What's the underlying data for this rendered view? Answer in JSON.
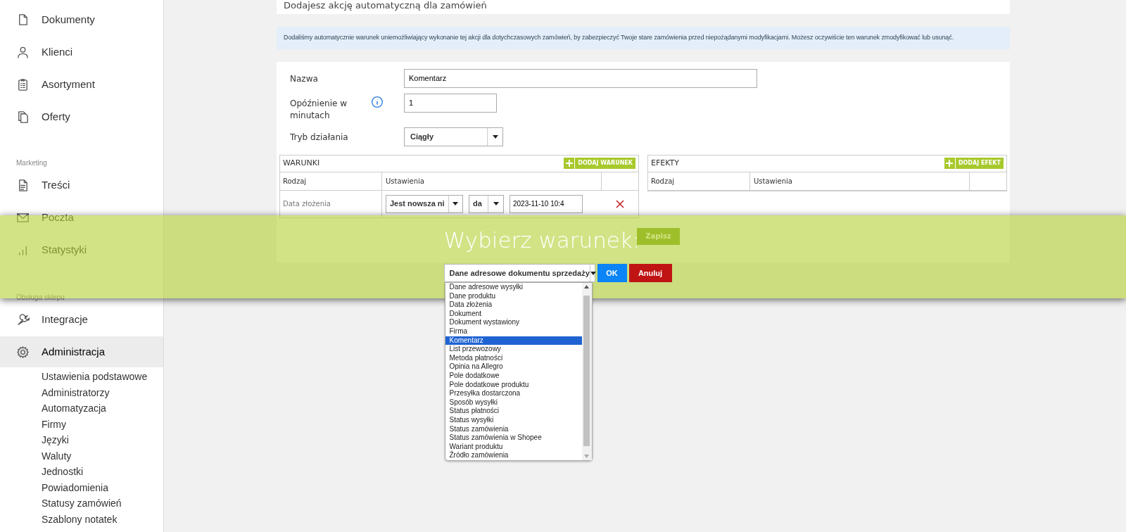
{
  "sidebar": {
    "sections": [
      {
        "items": [
          {
            "label": "Dokumenty",
            "selected": false
          },
          {
            "label": "Klienci",
            "selected": false
          },
          {
            "label": "Asortyment",
            "selected": false
          },
          {
            "label": "Oferty",
            "selected": false
          }
        ]
      },
      {
        "heading": "Marketing",
        "items": [
          {
            "label": "Treści",
            "selected": false
          },
          {
            "label": "Poczta",
            "selected": false
          },
          {
            "label": "Statystyki",
            "selected": false
          }
        ]
      },
      {
        "heading": "Obsługa sklepu",
        "items": [
          {
            "label": "Integracje",
            "selected": false
          },
          {
            "label": "Administracja",
            "selected": true,
            "children": [
              "Ustawienia podstawowe",
              "Administratorzy",
              "Automatyzacja",
              "Firmy",
              "Języki",
              "Waluty",
              "Jednostki",
              "Powiadomienia",
              "Statusy zamówień",
              "Szablony notatek"
            ]
          }
        ]
      }
    ]
  },
  "page_title": "Dodajesz akcję automatyczną dla zamówień",
  "notice": "Dodaliśmy automatycznie warunek uniemożliwiający wykonanie tej akcji dla dotychczasowych zamówień, by zabezpieczyć Twoje stare zamówienia przed niepożądanymi modyfikacjami. Możesz oczywiście ten warunek zmodyfikować lub usunąć.",
  "form": {
    "fields": [
      {
        "label": "Nazwa",
        "kind": "text",
        "value": "Komentarz",
        "info": false
      },
      {
        "label": "Opóźnienie w minutach",
        "kind": "text",
        "value": "1",
        "info": true
      },
      {
        "label": "Tryb działania",
        "kind": "select",
        "value": "Ciągły",
        "info": false
      }
    ]
  },
  "conditions": {
    "title": "WARUNKI",
    "add_button": "DODAJ WARUNEK",
    "columns": [
      "Rodzaj",
      "Ustawienia"
    ],
    "rows": [
      {
        "type": "Data złożenia",
        "operator": "Jest nowsza ni",
        "unit": "da",
        "date": "2023-11-10 10:4"
      }
    ]
  },
  "effects": {
    "title": "EFEKTY",
    "add_button": "DODAJ EFEKT",
    "columns": [
      "Rodzaj",
      "Ustawienia"
    ]
  },
  "save_button": "Zapisz",
  "dialog": {
    "title": "Wybierz warunek:",
    "select": {
      "value": "Dane adresowe dokumentu sprzedaży",
      "expanded": true,
      "options": [
        {
          "label": "Dane adresowe wysyłki",
          "selected": false
        },
        {
          "label": "Dane produktu",
          "selected": false
        },
        {
          "label": "Data złożenia",
          "selected": false
        },
        {
          "label": "Dokument",
          "selected": false
        },
        {
          "label": "Dokument wystawiony",
          "selected": false
        },
        {
          "label": "Firma",
          "selected": false
        },
        {
          "label": "Komentarz",
          "selected": true
        },
        {
          "label": "List przewozowy",
          "selected": false
        },
        {
          "label": "Metoda płatności",
          "selected": false
        },
        {
          "label": "Opinia na Allegro",
          "selected": false
        },
        {
          "label": "Pole dodatkowe",
          "selected": false
        },
        {
          "label": "Pole dodatkowe produktu",
          "selected": false
        },
        {
          "label": "Przesyłka dostarczona",
          "selected": false
        },
        {
          "label": "Sposób wysyłki",
          "selected": false
        },
        {
          "label": "Status płatności",
          "selected": false
        },
        {
          "label": "Status wysyłki",
          "selected": false
        },
        {
          "label": "Status zamówienia",
          "selected": false
        },
        {
          "label": "Status zamówienia w Shopee",
          "selected": false
        },
        {
          "label": "Wariant produktu",
          "selected": false
        },
        {
          "label": "Źródło zamówienia",
          "selected": false
        }
      ]
    },
    "ok_button": "OK",
    "cancel_button": "Anuluj"
  }
}
